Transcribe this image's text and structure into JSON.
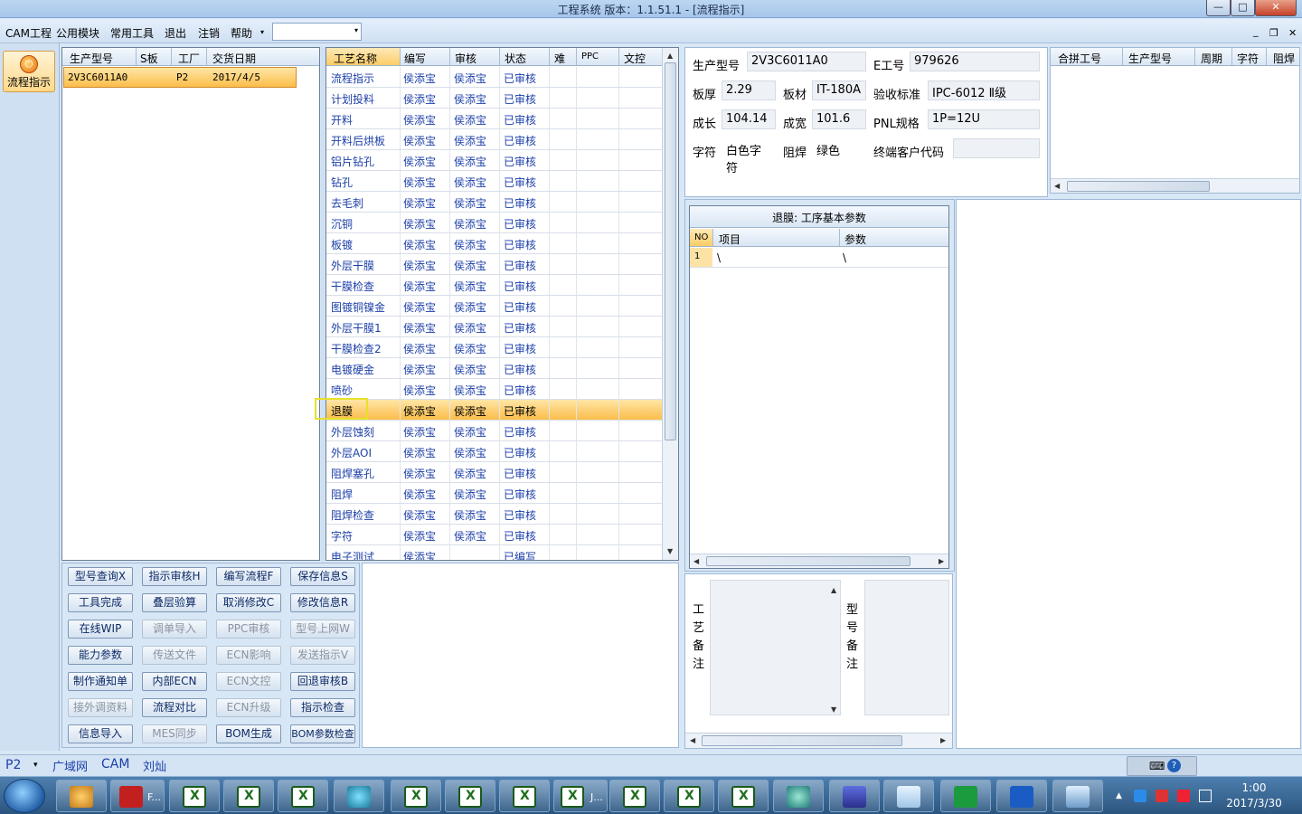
{
  "window": {
    "title": "工程系统   版本：1.1.51.1 - [流程指示]",
    "minimize": "—",
    "maximize": "□",
    "close": "✕"
  },
  "menu": {
    "items": [
      "CAM工程",
      "公用模块",
      "常用工具",
      "退出",
      "注销",
      "帮助"
    ],
    "help_arrow": "▾",
    "combo_value": "",
    "combo_arrow": "▾",
    "mdi_min": "_",
    "mdi_restore": "❐",
    "mdi_close": "✕"
  },
  "nav": {
    "button_label": "流程指示"
  },
  "order_grid": {
    "headers": [
      "生产型号",
      "S板",
      "工厂",
      "交货日期"
    ],
    "rows": [
      {
        "model": "2V3C6011A0",
        "s": "",
        "factory": "P2",
        "date": "2017/4/5"
      }
    ]
  },
  "process_grid": {
    "headers": [
      "工艺名称",
      "编写",
      "审核",
      "状态",
      "难",
      "PPC",
      "文控"
    ],
    "selected_index": 16,
    "rows": [
      [
        "流程指示",
        "侯添宝",
        "侯添宝",
        "已审核"
      ],
      [
        "计划投料",
        "侯添宝",
        "侯添宝",
        "已审核"
      ],
      [
        "开料",
        "侯添宝",
        "侯添宝",
        "已审核"
      ],
      [
        "开料后烘板",
        "侯添宝",
        "侯添宝",
        "已审核"
      ],
      [
        "铝片钻孔",
        "侯添宝",
        "侯添宝",
        "已审核"
      ],
      [
        "钻孔",
        "侯添宝",
        "侯添宝",
        "已审核"
      ],
      [
        "去毛刺",
        "侯添宝",
        "侯添宝",
        "已审核"
      ],
      [
        "沉铜",
        "侯添宝",
        "侯添宝",
        "已审核"
      ],
      [
        "板镀",
        "侯添宝",
        "侯添宝",
        "已审核"
      ],
      [
        "外层干膜",
        "侯添宝",
        "侯添宝",
        "已审核"
      ],
      [
        "干膜检查",
        "侯添宝",
        "侯添宝",
        "已审核"
      ],
      [
        "图镀铜镍金",
        "侯添宝",
        "侯添宝",
        "已审核"
      ],
      [
        "外层干膜1",
        "侯添宝",
        "侯添宝",
        "已审核"
      ],
      [
        "干膜检查2",
        "侯添宝",
        "侯添宝",
        "已审核"
      ],
      [
        "电镀硬金",
        "侯添宝",
        "侯添宝",
        "已审核"
      ],
      [
        "喷砂",
        "侯添宝",
        "侯添宝",
        "已审核"
      ],
      [
        "退膜",
        "侯添宝",
        "侯添宝",
        "已审核"
      ],
      [
        "外层蚀刻",
        "侯添宝",
        "侯添宝",
        "已审核"
      ],
      [
        "外层AOI",
        "侯添宝",
        "侯添宝",
        "已审核"
      ],
      [
        "阻焊塞孔",
        "侯添宝",
        "侯添宝",
        "已审核"
      ],
      [
        "阻焊",
        "侯添宝",
        "侯添宝",
        "已审核"
      ],
      [
        "阻焊检查",
        "侯添宝",
        "侯添宝",
        "已审核"
      ],
      [
        "字符",
        "侯添宝",
        "侯添宝",
        "已审核"
      ],
      [
        "电子测试",
        "侯添宝",
        "",
        "已编写"
      ]
    ]
  },
  "buttons": [
    {
      "label": "型号查询X",
      "enabled": true
    },
    {
      "label": "指示审核H",
      "enabled": true
    },
    {
      "label": "编写流程F",
      "enabled": true
    },
    {
      "label": "保存信息S",
      "enabled": true
    },
    {
      "label": "工具完成",
      "enabled": true
    },
    {
      "label": "叠层验算",
      "enabled": true
    },
    {
      "label": "取消修改C",
      "enabled": true
    },
    {
      "label": "修改信息R",
      "enabled": true
    },
    {
      "label": "在线WIP",
      "enabled": true
    },
    {
      "label": "调单导入",
      "enabled": false
    },
    {
      "label": "PPC审核",
      "enabled": false
    },
    {
      "label": "型号上网W",
      "enabled": false
    },
    {
      "label": "能力参数",
      "enabled": true
    },
    {
      "label": "传送文件",
      "enabled": false
    },
    {
      "label": "ECN影响",
      "enabled": false
    },
    {
      "label": "发送指示V",
      "enabled": false
    },
    {
      "label": "制作通知单",
      "enabled": true
    },
    {
      "label": "内部ECN",
      "enabled": true
    },
    {
      "label": "ECN文控",
      "enabled": false
    },
    {
      "label": "回退审核B",
      "enabled": true
    },
    {
      "label": "接外调资料",
      "enabled": false
    },
    {
      "label": "流程对比",
      "enabled": true
    },
    {
      "label": "ECN升级",
      "enabled": false
    },
    {
      "label": "指示检查",
      "enabled": true
    },
    {
      "label": "信息导入",
      "enabled": true
    },
    {
      "label": "MES同步",
      "enabled": false
    },
    {
      "label": "BOM生成",
      "enabled": true
    },
    {
      "label": "BOM参数检查",
      "enabled": true
    }
  ],
  "info": {
    "model_label": "生产型号",
    "model": "2V3C6011A0",
    "eno_label": "E工号",
    "eno": "979626",
    "thick_label": "板厚",
    "thick": "2.29",
    "material_label": "板材",
    "material": "IT-180A",
    "std_label": "验收标准",
    "std": "IPC-6012 Ⅱ级",
    "growth_label": "成长",
    "growth": "104.14",
    "width_label": "成宽",
    "width": "101.6",
    "pnl_label": "PNL规格",
    "pnl": "1P=12U",
    "char_label": "字符",
    "char": "白色字符",
    "mask_label": "阻焊",
    "mask": "绿色",
    "cust_label": "终端客户代码",
    "cust": ""
  },
  "merge_grid": {
    "headers": [
      "合拼工号",
      "生产型号",
      "周期",
      "字符",
      "阻焊"
    ]
  },
  "param_grid": {
    "title": "退膜: 工序基本参数",
    "headers": [
      "NO",
      "项目",
      "参数"
    ],
    "rows": [
      [
        "1",
        "\\",
        "\\"
      ]
    ]
  },
  "notes": {
    "process_label": "工艺备注",
    "model_label": "型号备注"
  },
  "status": {
    "factory": "P2",
    "arrow": "▾",
    "network": "广域网",
    "mode": "CAM",
    "user": "刘灿"
  },
  "taskbar": {
    "f_label": "F...",
    "j_label": "J...",
    "time": "1:00",
    "date": "2017/3/30"
  }
}
